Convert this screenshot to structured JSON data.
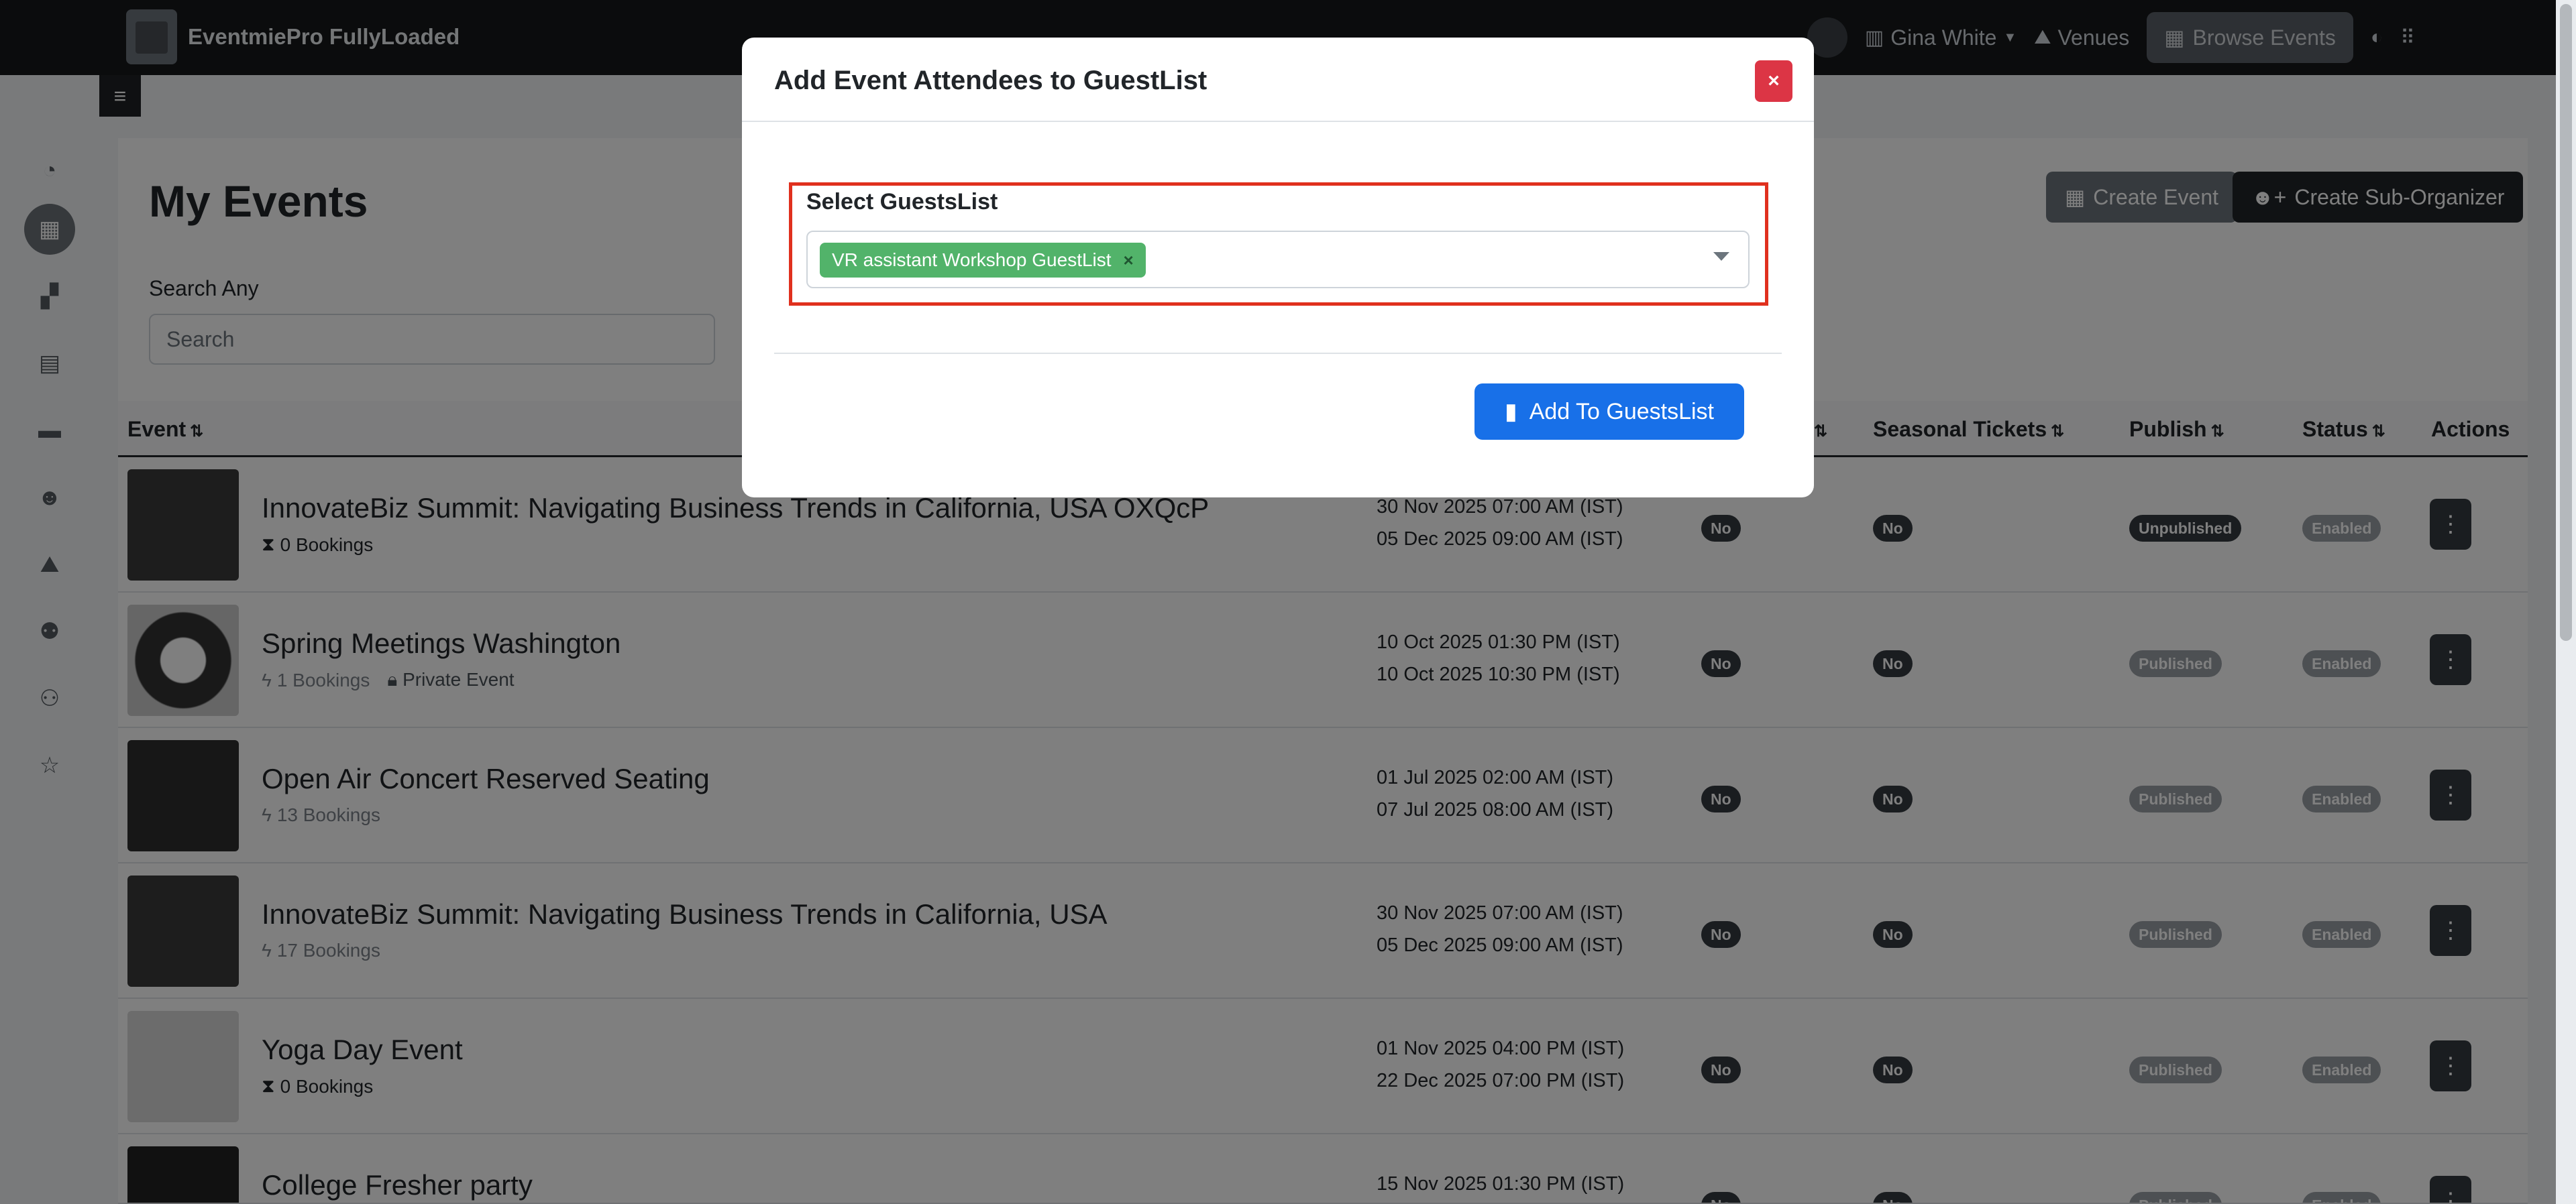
{
  "app": {
    "name": "EventmiePro FullyLoaded"
  },
  "navbar": {
    "user": "Gina White",
    "venues": "Venues",
    "browse_events": "Browse Events"
  },
  "page": {
    "title": "My Events",
    "search_label": "Search Any",
    "search_placeholder": "Search",
    "create_event": "Create Event",
    "create_sub_organizer": "Create Sub-Organizer"
  },
  "table": {
    "headers": {
      "event": "Event",
      "seasonal_tickets": "Seasonal Tickets",
      "publish": "Publish",
      "status": "Status",
      "actions": "Actions"
    },
    "rows": [
      {
        "title": "InnovateBiz Summit: Navigating Business Trends in California, USA OXQcP",
        "bookings": "0 Bookings",
        "private": "",
        "start": "30 Nov 2025 07:00 AM (IST)",
        "end": "05 Dec 2025 09:00 AM (IST)",
        "col1": "No",
        "seasonal": "No",
        "publish": "Unpublished",
        "status": "Enabled"
      },
      {
        "title": "Spring Meetings Washington",
        "bookings": "1 Bookings",
        "private": "Private Event",
        "start": "10 Oct 2025 01:30 PM (IST)",
        "end": "10 Oct 2025 10:30 PM (IST)",
        "col1": "No",
        "seasonal": "No",
        "publish": "Published",
        "status": "Enabled"
      },
      {
        "title": "Open Air Concert Reserved Seating",
        "bookings": "13 Bookings",
        "private": "",
        "start": "01 Jul 2025 02:00 AM (IST)",
        "end": "07 Jul 2025 08:00 AM (IST)",
        "col1": "No",
        "seasonal": "No",
        "publish": "Published",
        "status": "Enabled"
      },
      {
        "title": "InnovateBiz Summit: Navigating Business Trends in California, USA",
        "bookings": "17 Bookings",
        "private": "",
        "start": "30 Nov 2025 07:00 AM (IST)",
        "end": "05 Dec 2025 09:00 AM (IST)",
        "col1": "No",
        "seasonal": "No",
        "publish": "Published",
        "status": "Enabled"
      },
      {
        "title": "Yoga Day Event",
        "bookings": "0 Bookings",
        "private": "",
        "start": "01 Nov 2025 04:00 PM (IST)",
        "end": "22 Dec 2025 07:00 PM (IST)",
        "col1": "No",
        "seasonal": "No",
        "publish": "Published",
        "status": "Enabled"
      },
      {
        "title": "College Fresher party",
        "bookings": "",
        "private": "",
        "start": "15 Nov 2025 01:30 PM (IST)",
        "end": "",
        "col1": "No",
        "seasonal": "No",
        "publish": "Published",
        "status": "Enabled"
      }
    ]
  },
  "modal": {
    "title": "Add Event Attendees to GuestList",
    "close": "×",
    "select_label": "Select GuestsList",
    "selected_tag": "VR assistant Workshop GuestList",
    "tag_remove": "×",
    "submit": "Add To GuestsList"
  },
  "icons": {
    "sidebar": [
      "dashboard-icon",
      "calendar-icon",
      "grid-icon",
      "ticket-icon",
      "wallet-icon",
      "user-icon",
      "map-icon",
      "users-icon",
      "people-icon",
      "star-icon"
    ]
  },
  "colors": {
    "brand_dark": "#16181b",
    "primary": "#1870e8",
    "danger": "#dc3545",
    "tag_green": "#52b36a",
    "highlight_red": "#e0301e"
  }
}
